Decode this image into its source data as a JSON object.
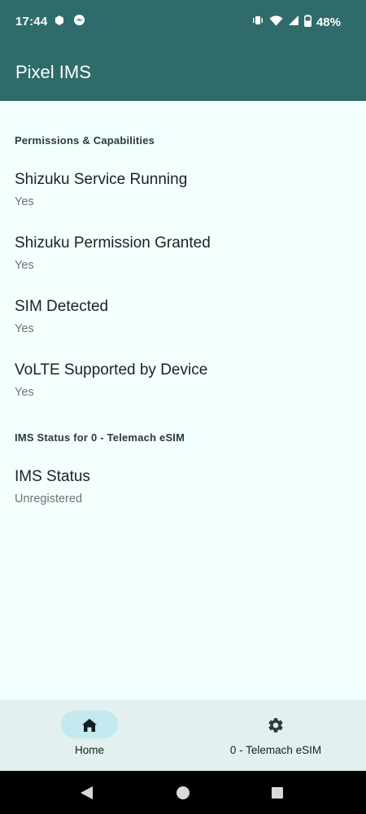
{
  "status_bar": {
    "time": "17:44",
    "battery": "48%"
  },
  "app_bar": {
    "title": "Pixel IMS"
  },
  "sections": [
    {
      "header": "Permissions & Capabilities",
      "items": [
        {
          "title": "Shizuku Service Running",
          "summary": "Yes"
        },
        {
          "title": "Shizuku Permission Granted",
          "summary": "Yes"
        },
        {
          "title": "SIM Detected",
          "summary": "Yes"
        },
        {
          "title": "VoLTE Supported by Device",
          "summary": "Yes"
        }
      ]
    },
    {
      "header": "IMS Status for 0 - Telemach eSIM",
      "items": [
        {
          "title": "IMS Status",
          "summary": "Unregistered"
        }
      ]
    }
  ],
  "bottom_nav": {
    "items": [
      {
        "label": "Home",
        "icon": "home-icon",
        "selected": true
      },
      {
        "label": "0 - Telemach eSIM",
        "icon": "gear-icon",
        "selected": false
      }
    ]
  },
  "colors": {
    "primary": "#306b6b",
    "background": "#f3fffd",
    "nav_background": "#e2f0ef",
    "nav_indicator": "#c4e8f0"
  }
}
